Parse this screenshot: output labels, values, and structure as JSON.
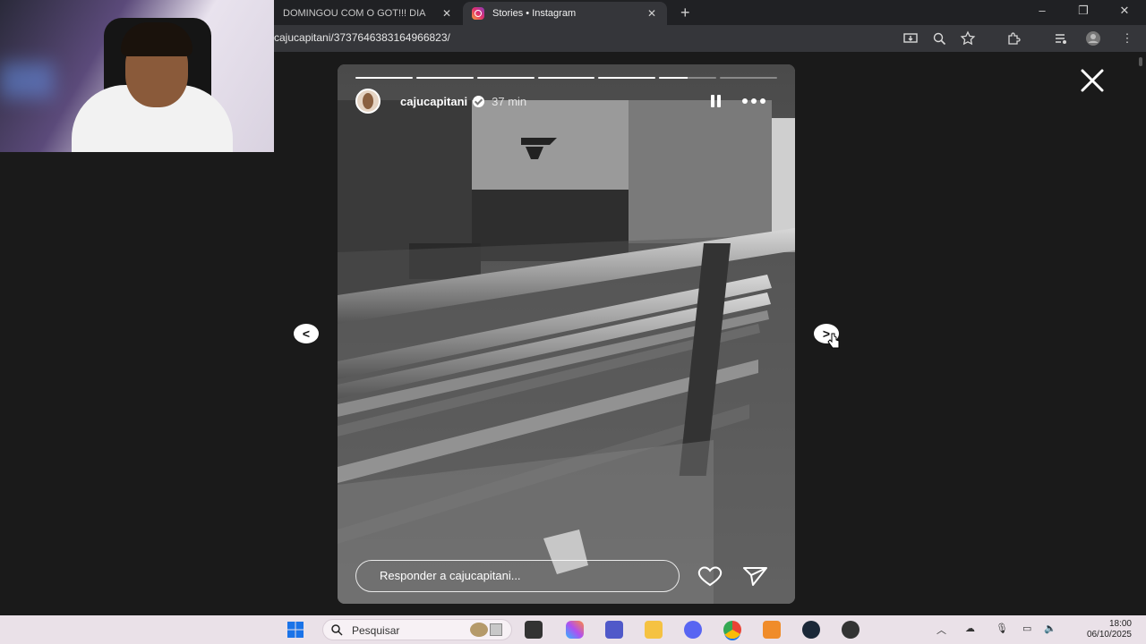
{
  "browser": {
    "tabs": [
      {
        "label": "DOMINGOU COM O GOT!!! DIA",
        "active": false
      },
      {
        "label": "Stories • Instagram",
        "active": true
      }
    ],
    "new_tab": "+",
    "window_controls": {
      "minimize": "–",
      "restore": "❐",
      "close": "✕"
    },
    "url": "cajucapitani/3737646383164966823/",
    "toolbar_icons": [
      "install-icon",
      "zoom-icon",
      "star-icon",
      "extensions-icon",
      "media-icon",
      "profile-icon",
      "menu-icon"
    ]
  },
  "story": {
    "username": "cajucapitani",
    "verified": true,
    "time": "37 min",
    "progress": [
      1,
      1,
      1,
      1,
      1,
      0.5,
      0
    ],
    "reply_placeholder": "Responder a cajucapitani...",
    "nav_prev": "<",
    "nav_next": ">"
  },
  "taskbar": {
    "search_label": "Pesquisar",
    "clock_time": "18:00",
    "clock_date": "06/10/2025"
  },
  "colors": {
    "page_bg": "#1a1a1a",
    "tabbar_bg": "#202124",
    "addressbar_bg": "#35363a",
    "taskbar_bg": "#eae1e8"
  }
}
